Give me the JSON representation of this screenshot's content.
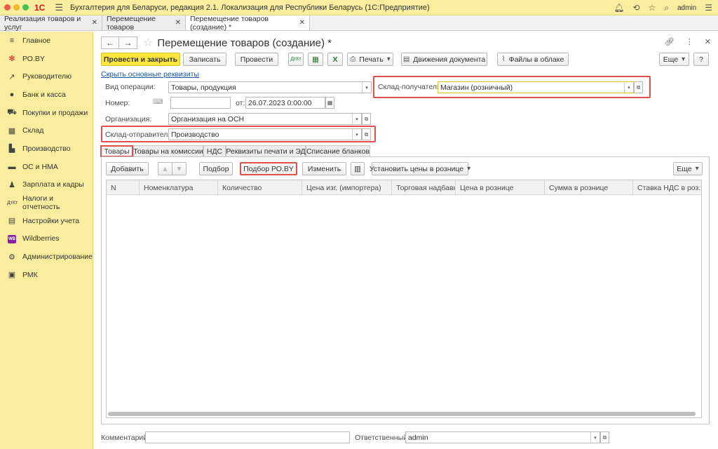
{
  "titlebar": {
    "logo": "1С",
    "menu_icon": "hamburger-icon",
    "app_title": "Бухгалтерия для Беларуси, редакция 2.1. Локализация для Республики Беларусь   (1С:Предприятие)",
    "user": "admin",
    "dot_colors": [
      "#f25a4a",
      "#f6b62a",
      "#44c14e"
    ]
  },
  "window_tabs": [
    {
      "label": "Реализация товаров и услуг"
    },
    {
      "label": "Перемещение товаров"
    },
    {
      "label": "Перемещение товаров (создание) *"
    }
  ],
  "sidebar": {
    "items": [
      {
        "label": "Главное",
        "icon": "menu-lines-icon"
      },
      {
        "label": "РО.BY",
        "icon": "sparkle-icon"
      },
      {
        "label": "Руководителю",
        "icon": "trend-icon"
      },
      {
        "label": "Банк и касса",
        "icon": "coin-icon"
      },
      {
        "label": "Покупки и продажи",
        "icon": "cart-icon"
      },
      {
        "label": "Склад",
        "icon": "warehouse-icon"
      },
      {
        "label": "Производство",
        "icon": "factory-icon"
      },
      {
        "label": "ОС и НМА",
        "icon": "truck-icon"
      },
      {
        "label": "Зарплата и кадры",
        "icon": "person-icon"
      },
      {
        "label": "Налоги и отчетность",
        "icon": "dt-kt-icon"
      },
      {
        "label": "Настройки учета",
        "icon": "settings-doc-icon"
      },
      {
        "label": "Wildberries",
        "icon": "wb-icon"
      },
      {
        "label": "Администрирование",
        "icon": "gear-icon"
      },
      {
        "label": "РМК",
        "icon": "register-icon"
      }
    ]
  },
  "form": {
    "title": "Перемещение товаров (создание) *",
    "buttons": {
      "post_close": "Провести и закрыть",
      "save": "Записать",
      "post": "Провести",
      "print": "Печать",
      "movements": "Движения документа",
      "cloud_files": "Файлы в облаке",
      "more": "Еще",
      "help": "?"
    },
    "hide_link": "Скрыть основные реквизиты",
    "fields": {
      "operation_label": "Вид операции:",
      "operation_value": "Товары, продукция",
      "number_label": "Номер:",
      "number_value": "",
      "date_label": "от:",
      "date_value": "26.07.2023  0:00:00",
      "org_label": "Организация:",
      "org_value": "Организация на ОСН",
      "sender_label": "Склад-отправитель:",
      "sender_value": "Производство",
      "receiver_label": "Склад-получатель:",
      "receiver_value": "Магазин (розничный)"
    },
    "tabs": [
      {
        "label": "Товары"
      },
      {
        "label": "Товары на комиссии"
      },
      {
        "label": "НДС"
      },
      {
        "label": "Реквизиты печати и ЭД"
      },
      {
        "label": "Списание бланков"
      }
    ],
    "table_toolbar": {
      "add": "Добавить",
      "pick": "Подбор",
      "pick_ro": "Подбор РО.BY",
      "change": "Изменить",
      "set_prices": "Установить цены в рознице",
      "more": "Еще"
    },
    "columns": [
      "N",
      "Номенклатура",
      "Количество",
      "Цена изг. (импортера)",
      "Торговая надбавка",
      "Цена в рознице",
      "Сумма в рознице",
      "Ставка НДС в роз..."
    ],
    "comment_label": "Комментарий:",
    "comment_value": "",
    "responsible_label": "Ответственный:",
    "responsible_value": "admin"
  }
}
